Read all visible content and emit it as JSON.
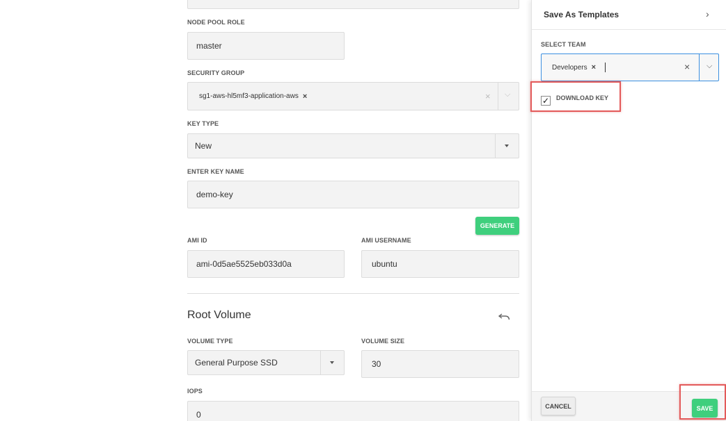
{
  "form": {
    "node_pool_role": {
      "label": "NODE POOL ROLE",
      "value": "master"
    },
    "security_group": {
      "label": "SECURITY GROUP",
      "chip": "sg1-aws-hl5mf3-application-aws",
      "chip_remove": "×",
      "clear": "×",
      "arrow": "⌵"
    },
    "key_type": {
      "label": "KEY TYPE",
      "value": "New"
    },
    "key_name": {
      "label": "ENTER KEY NAME",
      "value": "demo-key"
    },
    "generate_label": "GENERATE",
    "ami_id": {
      "label": "AMI ID",
      "value": "ami-0d5ae5525eb033d0a"
    },
    "ami_username": {
      "label": "AMI USERNAME",
      "value": "ubuntu"
    },
    "root_volume": {
      "title": "Root Volume",
      "volume_type": {
        "label": "VOLUME TYPE",
        "value": "General Purpose SSD"
      },
      "volume_size": {
        "label": "VOLUME SIZE",
        "value": "30"
      },
      "iops": {
        "label": "IOPS",
        "value": "0"
      }
    }
  },
  "panel": {
    "title": "Save As Templates",
    "chevron": "›",
    "select_team": {
      "label": "SELECT TEAM",
      "chip": "Developers",
      "chip_remove": "×",
      "clear": "×",
      "arrow": "⌵"
    },
    "download_key": {
      "label": "DOWNLOAD KEY",
      "checked": true,
      "check_glyph": "✓"
    },
    "cancel_label": "CANCEL",
    "save_label": "SAVE"
  },
  "colors": {
    "accent_green": "#3fcf7d",
    "focus_blue": "#3b8fe0",
    "highlight_red": "#e35a5a"
  }
}
